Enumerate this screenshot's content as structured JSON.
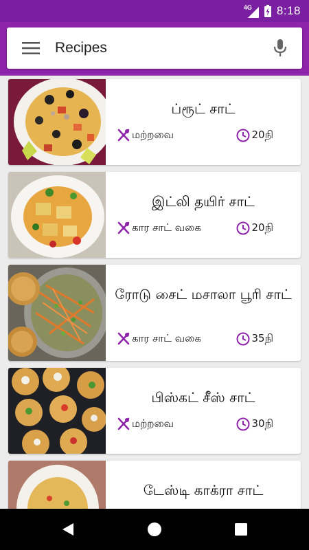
{
  "status_bar": {
    "network": "4G",
    "time": "8:18"
  },
  "app_bar": {
    "title": "Recipes",
    "menu_icon": "hamburger-menu-icon",
    "mic_icon": "microphone-icon"
  },
  "colors": {
    "primary_dark": "#7b1fa2",
    "primary": "#8e24aa",
    "accent_icon": "#8e24aa"
  },
  "recipes": [
    {
      "title": "ப்ரூட் சாட்",
      "category": "மற்றவை",
      "time": "20நி"
    },
    {
      "title": "இட்லி தயிர் சாட்",
      "category": "கார சாட் வகை",
      "time": "20நி"
    },
    {
      "title": "ரோடு சைட் மசாலா பூரி சாட்",
      "category": "கார சாட் வகை",
      "time": "35நி"
    },
    {
      "title": "பிஸ்கட் சீஸ் சாட்",
      "category": "மற்றவை",
      "time": "30நி"
    },
    {
      "title": "டேஸ்டி காக்ரா சாட்",
      "category": "",
      "time": ""
    }
  ],
  "nav_bar": {
    "back_icon": "back-triangle-icon",
    "home_icon": "home-circle-icon",
    "recents_icon": "recents-square-icon"
  }
}
